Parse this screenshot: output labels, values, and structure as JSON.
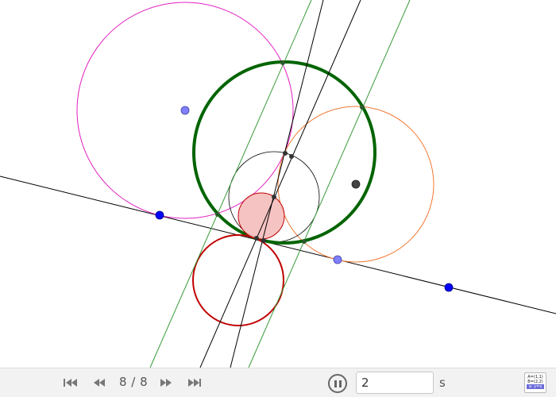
{
  "toolbar": {
    "step_label": "8 / 8",
    "speed_value": "2",
    "speed_unit": "s",
    "first_icon": "skip-to-start-icon",
    "prev_icon": "step-back-icon",
    "next_icon": "step-forward-icon",
    "last_icon": "skip-to-end-icon",
    "pause_icon": "pause-icon",
    "algebra_icon": "algebra-view-icon",
    "algebra_rows": [
      "A=(1,1)",
      "B=(2,2)",
      "a: y=x"
    ]
  },
  "colors": {
    "green_circle": "#006400",
    "magenta_circle": "#e020c0",
    "orange_circle": "#f07830",
    "red_circle": "#c00000",
    "pink_fill": "#f4b8b8",
    "blue_point": "#0000ff",
    "light_blue_point": "#8080ff",
    "line_green": "#3a9a3a",
    "line_black": "#000000"
  }
}
